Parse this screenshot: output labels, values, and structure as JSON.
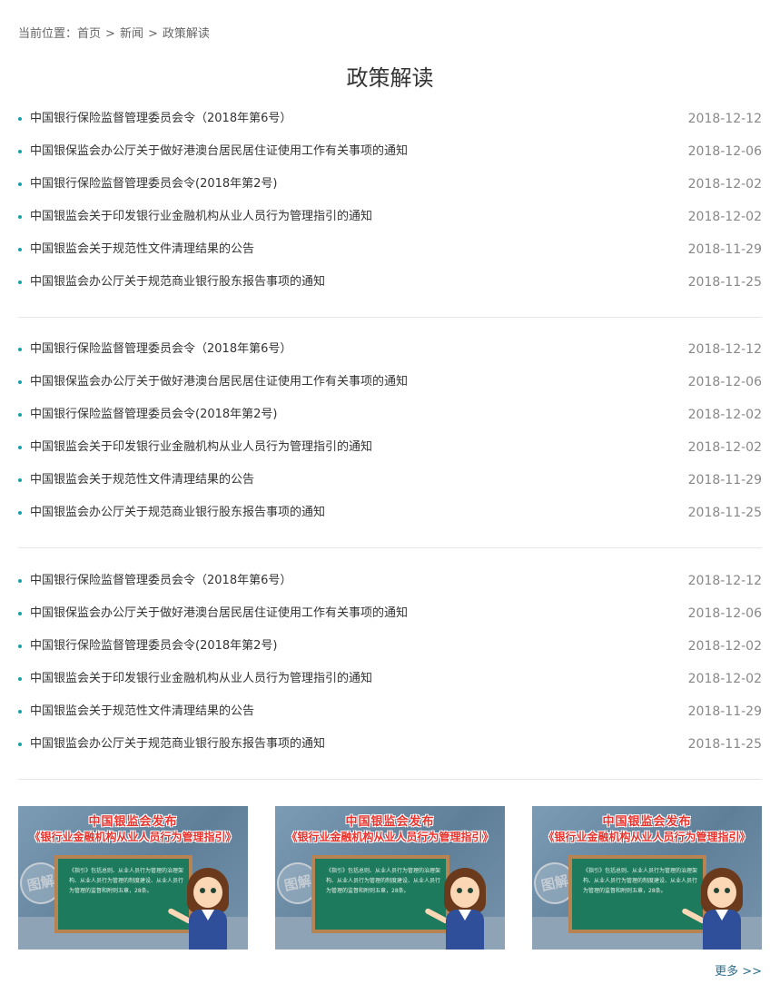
{
  "breadcrumb": {
    "prefix": "当前位置：",
    "items": [
      "首页",
      "新闻",
      "政策解读"
    ],
    "separator": ">"
  },
  "page_title": "政策解读",
  "sections": [
    {
      "items": [
        {
          "title": "中国银行保险监督管理委员会令（2018年第6号）",
          "date": "2018-12-12"
        },
        {
          "title": "中国银保监会办公厅关于做好港澳台居民居住证使用工作有关事项的通知",
          "date": "2018-12-06"
        },
        {
          "title": "中国银行保险监督管理委员会令(2018年第2号)",
          "date": "2018-12-02"
        },
        {
          "title": "中国银监会关于印发银行业金融机构从业人员行为管理指引的通知",
          "date": "2018-12-02"
        },
        {
          "title": "中国银监会关于规范性文件清理结果的公告",
          "date": "2018-11-29"
        },
        {
          "title": "中国银监会办公厅关于规范商业银行股东报告事项的通知",
          "date": "2018-11-25"
        }
      ]
    },
    {
      "items": [
        {
          "title": "中国银行保险监督管理委员会令（2018年第6号）",
          "date": "2018-12-12"
        },
        {
          "title": "中国银保监会办公厅关于做好港澳台居民居住证使用工作有关事项的通知",
          "date": "2018-12-06"
        },
        {
          "title": "中国银行保险监督管理委员会令(2018年第2号)",
          "date": "2018-12-02"
        },
        {
          "title": "中国银监会关于印发银行业金融机构从业人员行为管理指引的通知",
          "date": "2018-12-02"
        },
        {
          "title": "中国银监会关于规范性文件清理结果的公告",
          "date": "2018-11-29"
        },
        {
          "title": "中国银监会办公厅关于规范商业银行股东报告事项的通知",
          "date": "2018-11-25"
        }
      ]
    },
    {
      "items": [
        {
          "title": "中国银行保险监督管理委员会令（2018年第6号）",
          "date": "2018-12-12"
        },
        {
          "title": "中国银保监会办公厅关于做好港澳台居民居住证使用工作有关事项的通知",
          "date": "2018-12-06"
        },
        {
          "title": "中国银行保险监督管理委员会令(2018年第2号)",
          "date": "2018-12-02"
        },
        {
          "title": "中国银监会关于印发银行业金融机构从业人员行为管理指引的通知",
          "date": "2018-12-02"
        },
        {
          "title": "中国银监会关于规范性文件清理结果的公告",
          "date": "2018-11-29"
        },
        {
          "title": "中国银监会办公厅关于规范商业银行股东报告事项的通知",
          "date": "2018-11-25"
        }
      ]
    }
  ],
  "thumbnails": [
    {
      "headline": "中国银监会发布",
      "subheadline": "《银行业金融机构从业人员行为管理指引》",
      "stamp": "图解",
      "board_text": "《指引》包括总则、从业人员行为管理的治理架构、从业人员行为管理的制度建设、从业人员行为管理的监督和附则五章，28条。"
    },
    {
      "headline": "中国银监会发布",
      "subheadline": "《银行业金融机构从业人员行为管理指引》",
      "stamp": "图解",
      "board_text": "《指引》包括总则、从业人员行为管理的治理架构、从业人员行为管理的制度建设、从业人员行为管理的监督和附则五章，28条。"
    },
    {
      "headline": "中国银监会发布",
      "subheadline": "《银行业金融机构从业人员行为管理指引》",
      "stamp": "图解",
      "board_text": "《指引》包括总则、从业人员行为管理的治理架构、从业人员行为管理的制度建设、从业人员行为管理的监督和附则五章，28条。"
    }
  ],
  "more_link": "更多 >>",
  "colors": {
    "bullet": "#1aa0a8",
    "date": "#888888",
    "more": "#2d6d8c",
    "divider": "#e6e6e6"
  }
}
